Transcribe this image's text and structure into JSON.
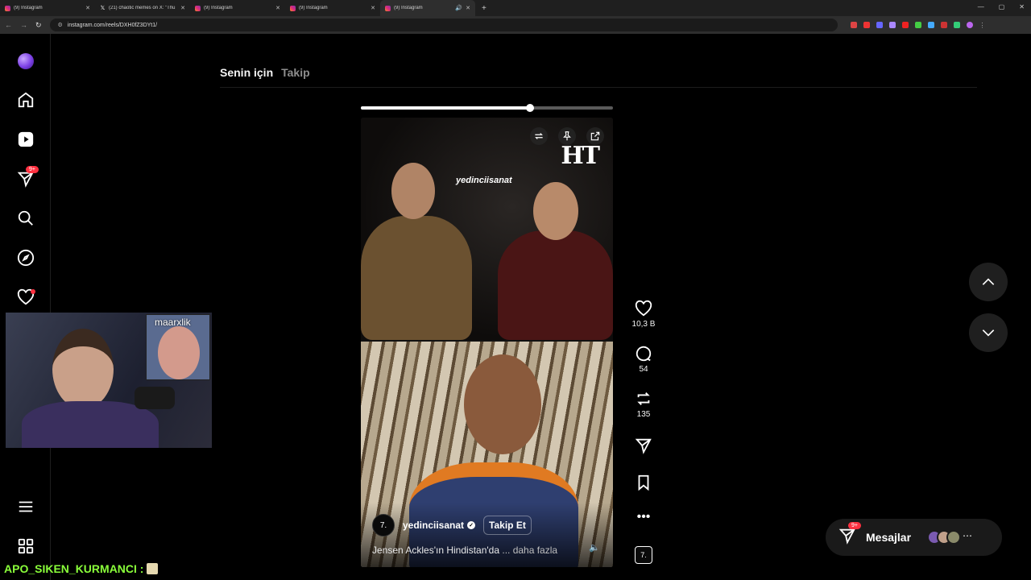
{
  "browser": {
    "tabs": [
      {
        "title": "(9) Instagram",
        "icon": "instagram-icon",
        "active": false
      },
      {
        "title": "(21) chaotic memes on X: \"Thu",
        "icon": "x-icon",
        "active": false
      },
      {
        "title": "(9) Instagram",
        "icon": "instagram-icon",
        "active": false
      },
      {
        "title": "(9) Instagram",
        "icon": "instagram-icon",
        "active": false
      },
      {
        "title": "(9) Instagram",
        "icon": "instagram-icon",
        "active": true
      }
    ],
    "url": "instagram.com/reels/DXH0fZ3DYt1/"
  },
  "sidebar": {
    "items": [
      {
        "name": "logo",
        "icon": "instagram-logo-icon"
      },
      {
        "name": "home",
        "icon": "home-icon"
      },
      {
        "name": "reels",
        "icon": "reels-icon"
      },
      {
        "name": "messages",
        "icon": "send-icon",
        "badge": "9+"
      },
      {
        "name": "search",
        "icon": "search-icon"
      },
      {
        "name": "explore",
        "icon": "compass-icon"
      },
      {
        "name": "notifications",
        "icon": "heart-icon"
      },
      {
        "name": "more",
        "icon": "menu-icon"
      },
      {
        "name": "also-from-meta",
        "icon": "grid-icon"
      }
    ]
  },
  "feed_tabs": {
    "for_you": "Senin için",
    "following": "Takip"
  },
  "reel": {
    "progress": 0.67,
    "watermark": "yedinciisanat",
    "publisher_mark": "HT",
    "username": "yedinciisanat",
    "follow_label": "Takip Et",
    "caption": "Jensen Ackles'ın Hindistan'da",
    "more_label": "... daha fazla",
    "avatar_text": "7."
  },
  "actions": {
    "likes": "10,3 B",
    "comments": "54",
    "reposts": "135"
  },
  "messages": {
    "label": "Mesajlar",
    "badge": "9+"
  },
  "overlay": {
    "cam_label": "maarxlik",
    "chat_user": "APO_SIKEN_KURMANCI :"
  },
  "colors": {
    "background": "#000000",
    "badge": "#ff3040",
    "chat": "#8aff3a"
  }
}
